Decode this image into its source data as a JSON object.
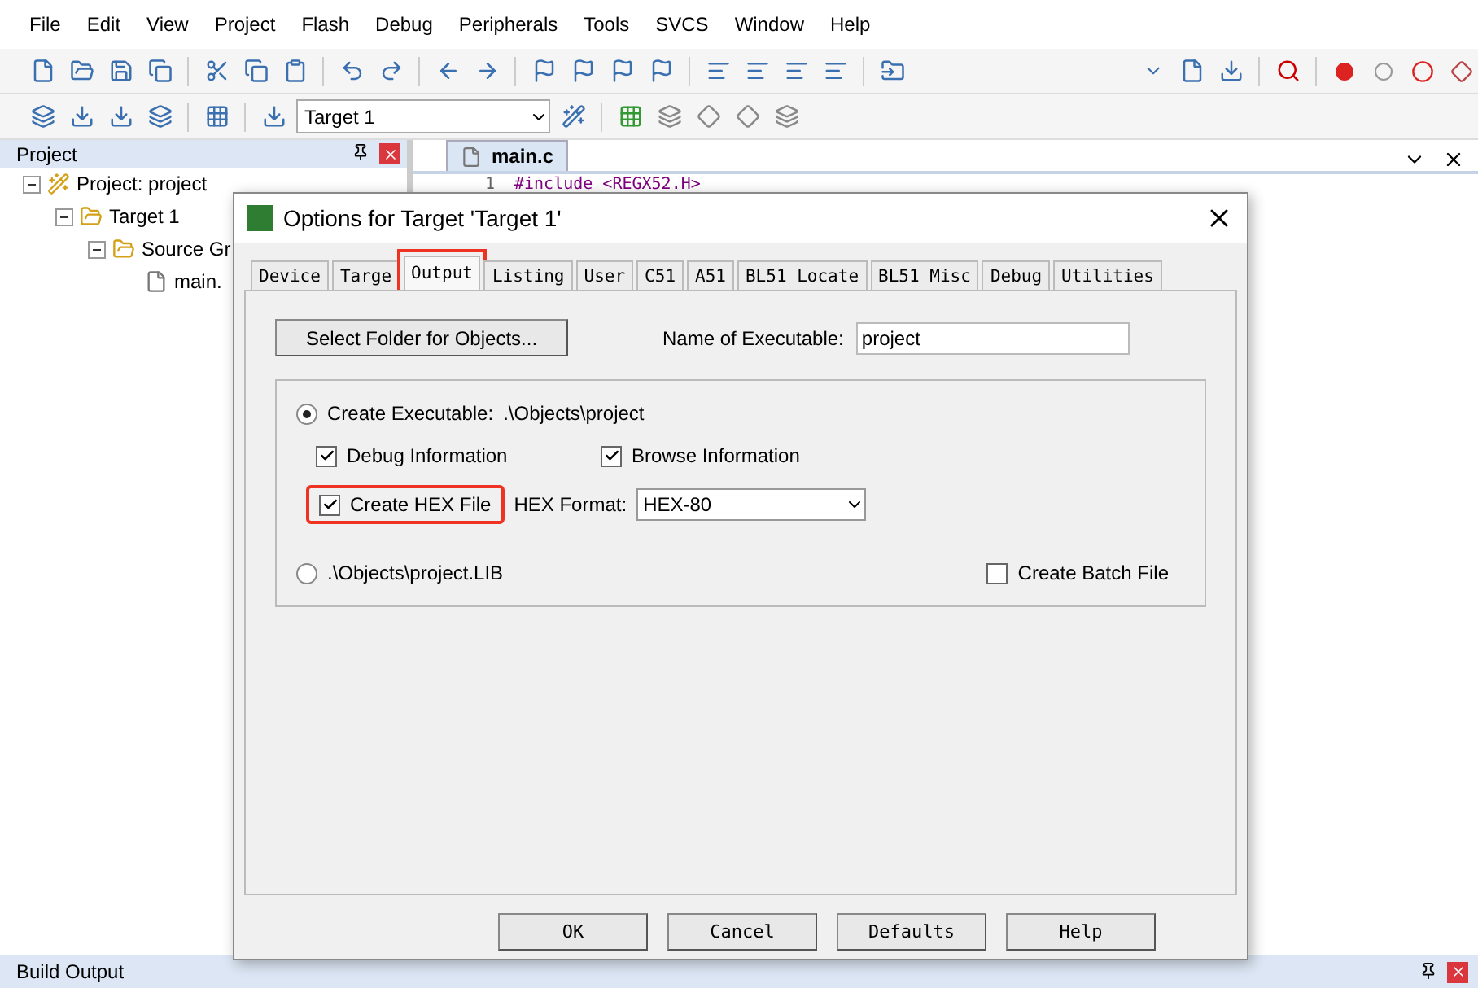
{
  "menu": [
    "File",
    "Edit",
    "View",
    "Project",
    "Flash",
    "Debug",
    "Peripherals",
    "Tools",
    "SVCS",
    "Window",
    "Help"
  ],
  "target_select": {
    "value": "Target 1"
  },
  "project_pane": {
    "title": "Project",
    "tree": [
      {
        "label": "Project: project",
        "kind": "project",
        "expanded": true,
        "children": [
          {
            "label": "Target 1",
            "kind": "target",
            "expanded": true,
            "children": [
              {
                "label": "Source Gr",
                "kind": "folder",
                "expanded": true,
                "children": [
                  {
                    "label": "main.",
                    "kind": "file"
                  }
                ]
              }
            ]
          }
        ]
      }
    ]
  },
  "editor": {
    "tab": "main.c",
    "lines": [
      {
        "number": "1",
        "code": "#include <REGX52.H>"
      }
    ]
  },
  "dialog": {
    "title": "Options for Target 'Target 1'",
    "tabs": [
      {
        "label": "Device",
        "selected": false,
        "highlighted": false
      },
      {
        "label": "Targe",
        "selected": false,
        "highlighted": false
      },
      {
        "label": "Output",
        "selected": true,
        "highlighted": true
      },
      {
        "label": "Listing",
        "selected": false,
        "highlighted": false
      },
      {
        "label": "User",
        "selected": false,
        "highlighted": false
      },
      {
        "label": "C51",
        "selected": false,
        "highlighted": false
      },
      {
        "label": "A51",
        "selected": false,
        "highlighted": false
      },
      {
        "label": "BL51 Locate",
        "selected": false,
        "highlighted": false
      },
      {
        "label": "BL51 Misc",
        "selected": false,
        "highlighted": false
      },
      {
        "label": "Debug",
        "selected": false,
        "highlighted": false
      },
      {
        "label": "Utilities",
        "selected": false,
        "highlighted": false
      }
    ],
    "select_folder_button": "Select Folder for Objects...",
    "name_label": "Name of Executable:",
    "name_value": "project",
    "create_executable": {
      "label": "Create Executable:",
      "path": ".\\Objects\\project",
      "selected": true
    },
    "debug_information": {
      "label": "Debug Information",
      "checked": true
    },
    "browse_information": {
      "label": "Browse Information",
      "checked": true
    },
    "create_hex": {
      "label": "Create HEX File",
      "checked": true,
      "highlighted": true
    },
    "hex_format": {
      "label": "HEX Format:",
      "value": "HEX-80"
    },
    "create_library": {
      "label": ".\\Objects\\project.LIB",
      "selected": false
    },
    "create_batch": {
      "label": "Create Batch File",
      "checked": false
    },
    "buttons": [
      "OK",
      "Cancel",
      "Defaults",
      "Help"
    ]
  },
  "build_output": {
    "title": "Build Output"
  }
}
